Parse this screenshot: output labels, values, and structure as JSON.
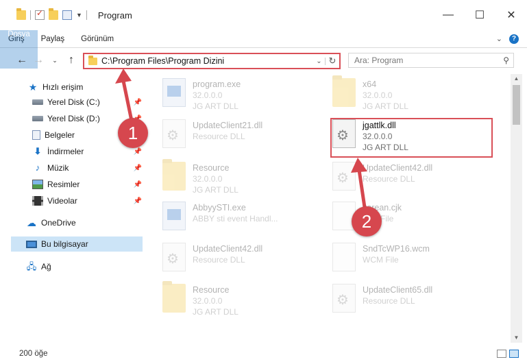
{
  "window": {
    "title": "Program"
  },
  "ribbon": {
    "tabs": [
      "Dosya",
      "Giriş",
      "Paylaş",
      "Görünüm"
    ]
  },
  "address": {
    "path": "C:\\Program Files\\Program Dizini"
  },
  "search": {
    "placeholder": "Ara: Program"
  },
  "sidebar": {
    "items": [
      {
        "label": "Hızlı erişim",
        "icon": "star-icon"
      },
      {
        "label": "Yerel Disk (C:)",
        "icon": "disk-icon"
      },
      {
        "label": "Yerel Disk (D:)",
        "icon": "disk-icon"
      },
      {
        "label": "Belgeler",
        "icon": "documents-icon"
      },
      {
        "label": "İndirmeler",
        "icon": "downloads-icon"
      },
      {
        "label": "Müzik",
        "icon": "music-icon"
      },
      {
        "label": "Resimler",
        "icon": "pictures-icon"
      },
      {
        "label": "Videolar",
        "icon": "videos-icon"
      },
      {
        "label": "OneDrive",
        "icon": "cloud-icon"
      },
      {
        "label": "Bu bilgisayar",
        "icon": "computer-icon"
      },
      {
        "label": "Ağ",
        "icon": "network-icon"
      }
    ]
  },
  "files": [
    {
      "name": "program.exe",
      "line2": "32.0.0.0",
      "line3": "JG ART DLL",
      "icon": "exe"
    },
    {
      "name": "x64",
      "line2": "32.0.0.0",
      "line3": "JG ART DLL",
      "icon": "folder"
    },
    {
      "name": "UpdateClient21.dll",
      "line2": "Resource DLL",
      "line3": "",
      "icon": "dll"
    },
    {
      "name": "jgattlk.dll",
      "line2": "32.0.0.0",
      "line3": "JG ART DLL",
      "icon": "dll"
    },
    {
      "name": "Resource",
      "line2": "32.0.0.0",
      "line3": "JG ART DLL",
      "icon": "folder"
    },
    {
      "name": "UpdateClient42.dll",
      "line2": "Resource DLL",
      "line3": "",
      "icon": "dll"
    },
    {
      "name": "AbbyySTI.exe",
      "line2": "ABBY sti event Handl...",
      "line3": "",
      "icon": "exe"
    },
    {
      "name": "korean.cjk",
      "line2": "CJK File",
      "line3": "",
      "icon": "blank"
    },
    {
      "name": "UpdateClient42.dll",
      "line2": "Resource DLL",
      "line3": "",
      "icon": "dll"
    },
    {
      "name": "SndTcWP16.wcm",
      "line2": "WCM File",
      "line3": "",
      "icon": "blank"
    },
    {
      "name": "Resource",
      "line2": "32.0.0.0",
      "line3": "JG ART DLL",
      "icon": "folder"
    },
    {
      "name": "UpdateClient65.dll",
      "line2": "Resource DLL",
      "line3": "",
      "icon": "dll"
    }
  ],
  "status": {
    "count": "200 öğe"
  },
  "callouts": [
    "1",
    "2"
  ],
  "colors": {
    "accent": "#1a73c6",
    "callout": "#d6474e"
  }
}
